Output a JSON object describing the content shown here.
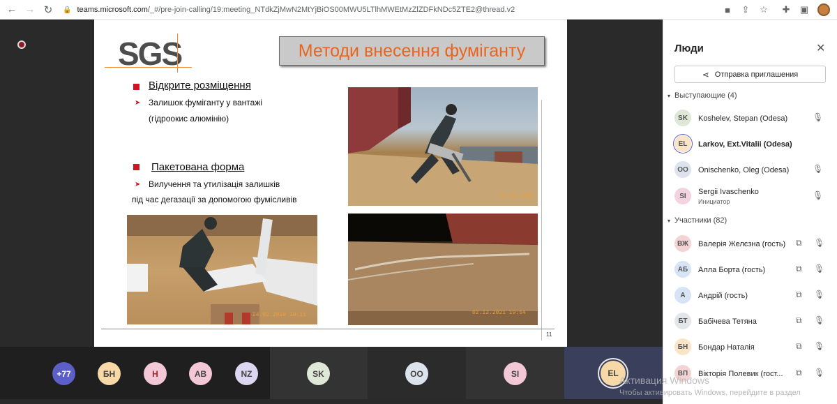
{
  "browser": {
    "back": "←",
    "forward": "→",
    "reload": "↻",
    "url_host": "teams.microsoft.com",
    "url_path": "/_#/pre-join-calling/19:meeting_NTdkZjMwN2MtYjBiOS00MWU5LTlhMWEtMzZlZDFkNDc5ZTE2@thread.v2"
  },
  "slide": {
    "logo": "SGS",
    "title": "Методи внесення фуміганту",
    "section1_head": "Відкрите розміщення",
    "section1_line1": "Залишок фуміганту у вантажі",
    "section1_line2": "(гідроокис алюмінію)",
    "section2_head": "Пакетована форма",
    "section2_line1": "Вилучення та утилізація залишків",
    "section2_line2": "під час дегазації за допомогою фумісливів",
    "photo1_ts": "24.03.2020",
    "photo2_ts": "24.02.2019 19:11",
    "photo3_ts": "02.12.2021  19:54",
    "page_number": "11"
  },
  "stage_tiles": [
    {
      "initials": "+77",
      "color": "#5b5fc7",
      "text_color": "#ffffff"
    },
    {
      "initials": "БН",
      "color": "#f7d9a8",
      "text_color": "#444444"
    },
    {
      "initials": "Н",
      "color": "#f3c8d6",
      "text_color": "#a4262c"
    },
    {
      "initials": "AB",
      "color": "#f3c8d6",
      "text_color": "#444444"
    },
    {
      "initials": "NZ",
      "color": "#dcd6f0",
      "text_color": "#444444"
    },
    {
      "initials": "SK",
      "color": "#dfe7d6",
      "text_color": "#444444"
    },
    {
      "initials": "OO",
      "color": "#dde3ec",
      "text_color": "#444444"
    },
    {
      "initials": "SI",
      "color": "#f3c8d6",
      "text_color": "#444444"
    },
    {
      "initials": "EL",
      "color": "#f7d9a8",
      "text_color": "#444444"
    }
  ],
  "panel": {
    "title": "Люди",
    "invite_label": "Отправка приглашения",
    "presenters_head": "Выступающие  (4)",
    "attendees_head": "Участники  (82)",
    "presenters": [
      {
        "initials": "SK",
        "name": "Koshelev, Stepan (Odesa)",
        "color": "#dfe7d6",
        "bold": false,
        "sub": ""
      },
      {
        "initials": "EL",
        "name": "Larkov, Ext.Vitalii (Odesa)",
        "color": "#f9e4c8",
        "bold": true,
        "sub": ""
      },
      {
        "initials": "OO",
        "name": "Onischenko, Oleg (Odesa)",
        "color": "#dde3ec",
        "bold": false,
        "sub": ""
      },
      {
        "initials": "SI",
        "name": "Sergii Ivaschenko",
        "color": "#f3d3e0",
        "bold": false,
        "sub": "Инициатор"
      }
    ],
    "attendees": [
      {
        "initials": "ВЖ",
        "name": "Валерія Желєзна (гость)",
        "color": "#f3d3d3"
      },
      {
        "initials": "АБ",
        "name": "Алла Борта (гость)",
        "color": "#d6e4f5"
      },
      {
        "initials": "А",
        "name": "Андрій (гость)",
        "color": "#d6e4f5"
      },
      {
        "initials": "БТ",
        "name": "Бабічева Тетяна",
        "color": "#e3e6eb"
      },
      {
        "initials": "БН",
        "name": "Бондар Наталія",
        "color": "#f9e4c8"
      },
      {
        "initials": "ВП",
        "name": "Вікторія Полевик (гост...",
        "color": "#f3d3d3"
      }
    ]
  },
  "watermark": {
    "line1": "Активация Windows",
    "line2": "Чтобы активировать Windows, перейдите в раздел"
  }
}
